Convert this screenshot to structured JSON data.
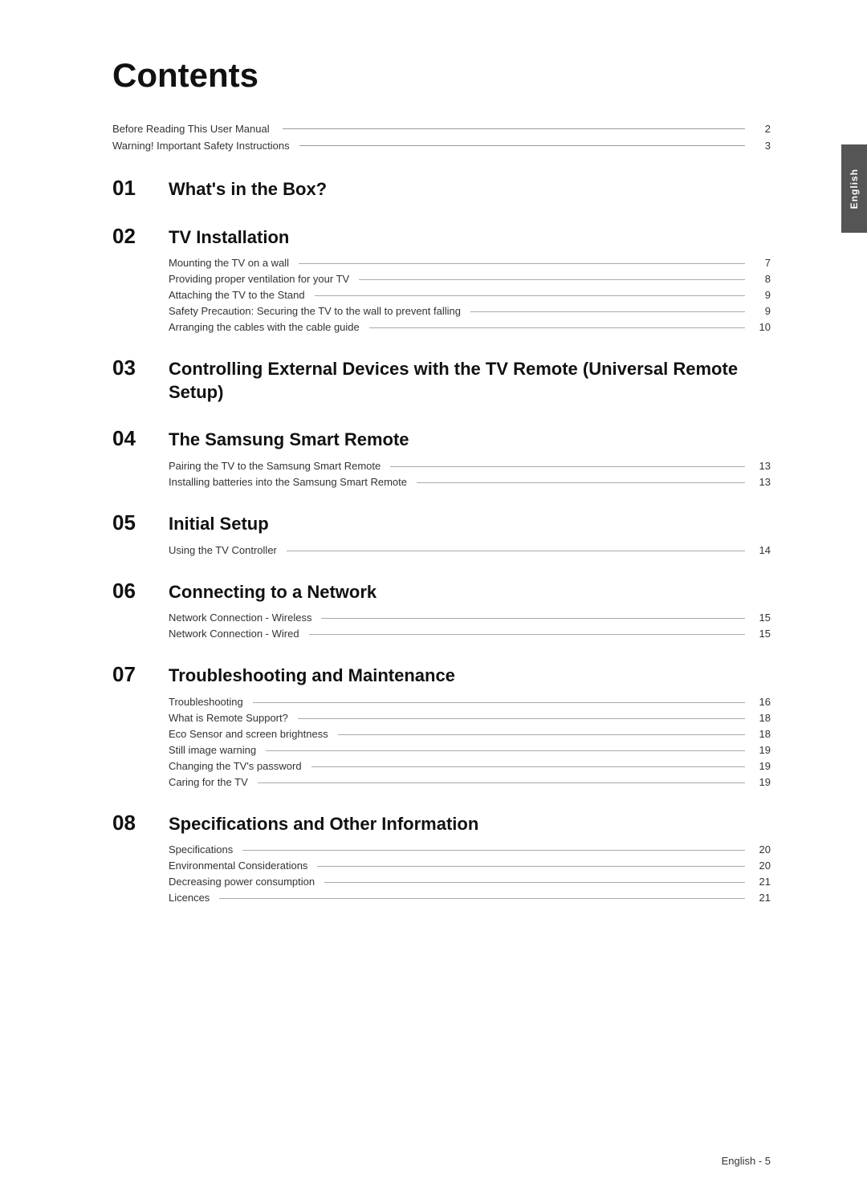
{
  "page": {
    "title": "Contents",
    "sidebar_label": "English",
    "footer": "English - 5"
  },
  "pre_sections": [
    {
      "label": "Before Reading This User Manual",
      "page": "2"
    },
    {
      "label": "Warning! Important Safety Instructions",
      "page": "3"
    }
  ],
  "sections": [
    {
      "number": "01",
      "title": "What's in the Box?",
      "items": []
    },
    {
      "number": "02",
      "title": "TV Installation",
      "items": [
        {
          "label": "Mounting the TV on a wall",
          "page": "7"
        },
        {
          "label": "Providing proper ventilation for your TV",
          "page": "8"
        },
        {
          "label": "Attaching the TV to the Stand",
          "page": "9"
        },
        {
          "label": "Safety Precaution: Securing the TV to the wall to prevent falling",
          "page": "9",
          "multiline": true
        },
        {
          "label": "Arranging the cables with the cable guide",
          "page": "10"
        }
      ]
    },
    {
      "number": "03",
      "title": "Controlling External Devices with the TV Remote (Universal Remote Setup)",
      "title_multiline": true,
      "items": []
    },
    {
      "number": "04",
      "title": "The Samsung Smart Remote",
      "items": [
        {
          "label": "Pairing the TV to the Samsung Smart Remote",
          "page": "13"
        },
        {
          "label": "Installing batteries into the Samsung Smart Remote",
          "page": "13"
        }
      ]
    },
    {
      "number": "05",
      "title": "Initial Setup",
      "items": [
        {
          "label": "Using the TV Controller",
          "page": "14"
        }
      ]
    },
    {
      "number": "06",
      "title": "Connecting to a Network",
      "items": [
        {
          "label": "Network Connection - Wireless",
          "page": "15"
        },
        {
          "label": "Network Connection - Wired",
          "page": "15"
        }
      ]
    },
    {
      "number": "07",
      "title": "Troubleshooting and Maintenance",
      "items": [
        {
          "label": "Troubleshooting",
          "page": "16"
        },
        {
          "label": "What is Remote Support?",
          "page": "18"
        },
        {
          "label": "Eco Sensor and screen brightness",
          "page": "18"
        },
        {
          "label": "Still image warning",
          "page": "19"
        },
        {
          "label": "Changing the TV's password",
          "page": "19"
        },
        {
          "label": "Caring for the TV",
          "page": "19"
        }
      ]
    },
    {
      "number": "08",
      "title": "Specifications and Other Information",
      "items": [
        {
          "label": "Specifications",
          "page": "20"
        },
        {
          "label": "Environmental Considerations",
          "page": "20"
        },
        {
          "label": "Decreasing power consumption",
          "page": "21"
        },
        {
          "label": "Licences",
          "page": "21"
        }
      ]
    }
  ]
}
